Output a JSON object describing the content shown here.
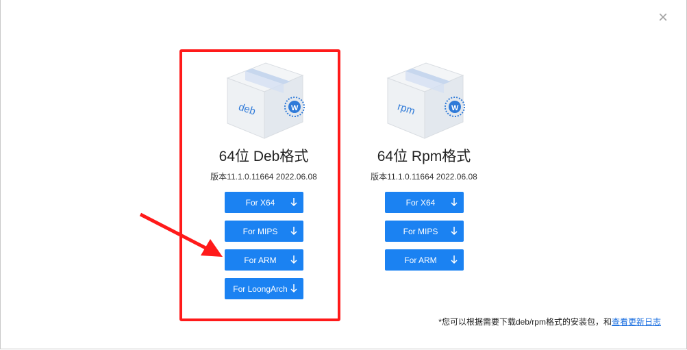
{
  "dialog": {
    "close_label": "×"
  },
  "packages": [
    {
      "box_label": "deb",
      "title": "64位 Deb格式",
      "version": "版本11.1.0.11664 2022.06.08",
      "buttons": [
        "For X64",
        "For MIPS",
        "For ARM",
        "For LoongArch"
      ]
    },
    {
      "box_label": "rpm",
      "title": "64位 Rpm格式",
      "version": "版本11.1.0.11664 2022.06.08",
      "buttons": [
        "For X64",
        "For MIPS",
        "For ARM"
      ]
    }
  ],
  "footer": {
    "note": "*您可以根据需要下载deb/rpm格式的安装包，和",
    "link": "查看更新日志"
  },
  "colors": {
    "button": "#1b82f2",
    "highlight": "#ff1a1a",
    "annotation_arrow": "#ff1a1a"
  },
  "icons": [
    "close-icon",
    "package-box-icon",
    "download-arrow-icon",
    "annotation-arrow"
  ]
}
